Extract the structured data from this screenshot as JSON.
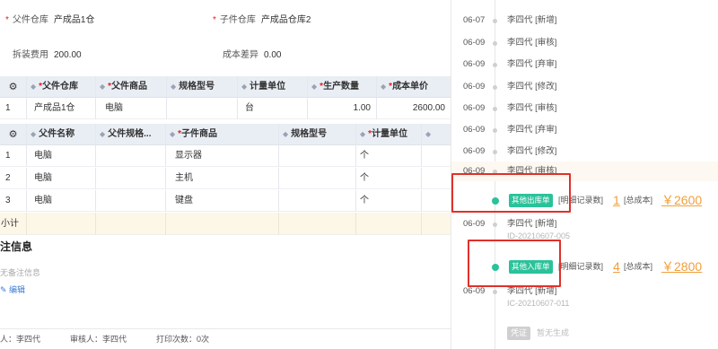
{
  "header": {
    "parent_wh_label": "父件仓库",
    "parent_wh_value": "产成品1仓",
    "child_wh_label": "子件仓库",
    "child_wh_value": "产成品仓库2",
    "disassembly_label": "拆装费用",
    "disassembly_value": "200.00",
    "cost_diff_label": "成本差异",
    "cost_diff_value": "0.00"
  },
  "parent_grid": {
    "headers": [
      "父件仓库",
      "父件商品",
      "规格型号",
      "计量单位",
      "生产数量",
      "成本单价"
    ],
    "row": {
      "no": "1",
      "warehouse": "产成品1仓",
      "product": "电脑",
      "spec": "",
      "unit": "台",
      "qty": "1.00",
      "unit_cost": "2600.00"
    }
  },
  "child_grid": {
    "headers": [
      "父件名称",
      "父件规格...",
      "子件商品",
      "规格型号",
      "计量单位"
    ],
    "rows": [
      {
        "no": "1",
        "parent": "电脑",
        "parent_spec": "",
        "child": "显示器",
        "spec": "",
        "unit": "个"
      },
      {
        "no": "2",
        "parent": "电脑",
        "parent_spec": "",
        "child": "主机",
        "spec": "",
        "unit": "个"
      },
      {
        "no": "3",
        "parent": "电脑",
        "parent_spec": "",
        "child": "键盘",
        "spec": "",
        "unit": "个"
      }
    ],
    "subtotal_label": "小计"
  },
  "notes": {
    "title": "注信息",
    "empty": "无备注信息",
    "edit": "编辑"
  },
  "footer": {
    "maker": "人：李四代",
    "auditor": "审核人：李四代",
    "print_count": "打印次数：0次"
  },
  "timeline": [
    {
      "date": "06-07",
      "text": "李四代 [新增]"
    },
    {
      "date": "06-09",
      "text": "李四代 [审核]"
    },
    {
      "date": "06-09",
      "text": "李四代 [弃审]"
    },
    {
      "date": "06-09",
      "text": "李四代 [修改]"
    },
    {
      "date": "06-09",
      "text": "李四代 [审核]"
    },
    {
      "date": "06-09",
      "text": "李四代 [弃审]"
    },
    {
      "date": "06-09",
      "text": "李四代 [修改]"
    },
    {
      "date": "06-09",
      "text": "李四代 [审核]"
    }
  ],
  "bill_out": {
    "tag": "其他出库单",
    "detail_label": "[明细记录数]",
    "detail_count": "1",
    "cost_label": "[总成本]",
    "cost": "￥2600"
  },
  "after_out": {
    "date": "06-09",
    "text": "李四代 [新增]",
    "id": "ID-20210607-005"
  },
  "bill_in": {
    "tag": "其他入库单",
    "detail_label": "[明细记录数]",
    "detail_count": "4",
    "cost_label": "[总成本]",
    "cost": "￥2800"
  },
  "after_in": {
    "date": "06-09",
    "text": "李四代 [新增]",
    "id": "IC-20210607-011"
  },
  "voucher": {
    "tag": "凭证",
    "note": "暂无生成"
  },
  "colors": {
    "accent_green": "#2bc29a",
    "cost_orange": "#f0a03c",
    "highlight_red": "#e0302a",
    "required_red": "#e02020"
  }
}
